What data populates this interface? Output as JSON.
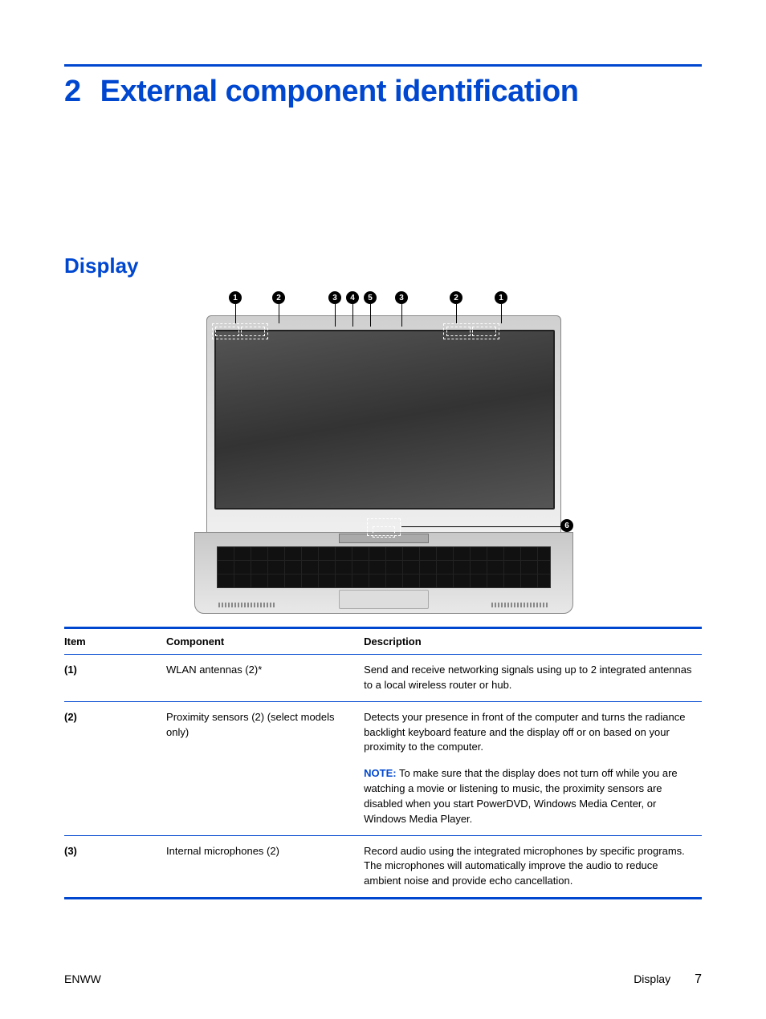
{
  "chapter": {
    "number": "2",
    "title": "External component identification"
  },
  "section": {
    "title": "Display"
  },
  "callouts": [
    "1",
    "2",
    "3",
    "4",
    "5",
    "3",
    "2",
    "1",
    "6"
  ],
  "table": {
    "headers": {
      "item": "Item",
      "component": "Component",
      "description": "Description"
    },
    "rows": [
      {
        "item": "(1)",
        "component": "WLAN antennas (2)*",
        "description": "Send and receive networking signals using up to 2 integrated antennas to a local wireless router or hub."
      },
      {
        "item": "(2)",
        "component": "Proximity sensors (2) (select models only)",
        "description": "Detects your presence in front of the computer and turns the radiance backlight keyboard feature and the display off or on based on your proximity to the computer.",
        "note_label": "NOTE:",
        "note_text": "To make sure that the display does not turn off while you are watching a movie or listening to music, the proximity sensors are disabled when you start PowerDVD, Windows Media Center, or Windows Media Player."
      },
      {
        "item": "(3)",
        "component": "Internal microphones (2)",
        "description": "Record audio using the integrated microphones by specific programs. The microphones will automatically improve the audio to reduce ambient noise and provide echo cancellation."
      }
    ]
  },
  "footer": {
    "left": "ENWW",
    "right_label": "Display",
    "page": "7"
  }
}
